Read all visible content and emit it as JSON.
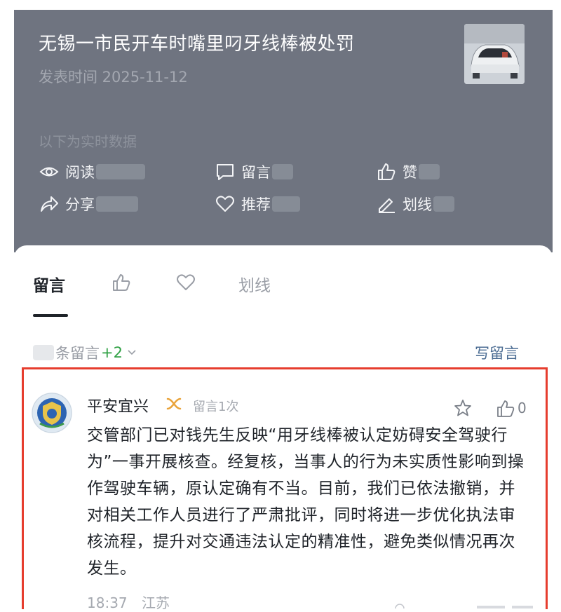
{
  "article": {
    "title": "无锡一市民开车时嘴里叼牙线棒被处罚",
    "publish_time": "发表时间 2025-11-12",
    "realtime_label": "以下为实时数据",
    "stats": {
      "read": "阅读",
      "comment": "留言",
      "like": "赞",
      "share": "分享",
      "recommend": "推荐",
      "underline": "划线"
    }
  },
  "tabs": {
    "comments": "留言",
    "underline": "划线"
  },
  "comment_header": {
    "count_suffix": "条留言",
    "plus": "+2",
    "write": "写留言"
  },
  "comment": {
    "username": "平安宜兴",
    "count_label": "留言1次",
    "likes": "0",
    "text": "交管部门已对钱先生反映“用牙线棒被认定妨碍安全驾驶行为”一事开展核查。经复核，当事人的行为未实质性影响到操作驾驶车辆，原认定确有不当。目前，我们已依法撤销，并对相关工作人员进行了严肃批评，同时将进一步优化执法审核流程，提升对交通违法认定的精准性，避免类似情况再次发生。",
    "time": "18:37",
    "location": "江苏"
  },
  "colors": {
    "panel": "#6f7480",
    "highlight_border": "#e63d2e",
    "link": "#4a6b92",
    "plus_green": "#2ea043"
  }
}
